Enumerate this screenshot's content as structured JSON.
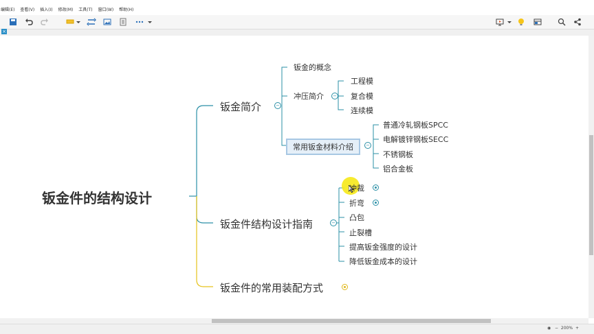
{
  "menu": {
    "items": [
      "编辑(E)",
      "查看(V)",
      "插入(I)",
      "修改(M)",
      "工具(T)",
      "窗口(W)",
      "帮助(H)"
    ]
  },
  "toolbar": {
    "left_icons": [
      "save-icon",
      "undo-icon",
      "redo-icon",
      "format-painter-icon",
      "dropdown-icon",
      "relationship-icon",
      "picture-icon",
      "outline-icon",
      "more-icon",
      "dropdown-icon"
    ],
    "right_icons": [
      "present-icon",
      "dropdown-icon",
      "bulb-icon",
      "panel-icon",
      "search-icon",
      "share-icon"
    ]
  },
  "mindmap": {
    "central": "钣金件的结构设计",
    "branch1": {
      "label": "钣金简介",
      "children": {
        "c1": "钣金的概念",
        "c2": {
          "label": "冲压简介",
          "items": [
            "工程模",
            "复合模",
            "连续模"
          ]
        },
        "c3": {
          "label": "常用钣金材料介绍",
          "items": [
            "普通冷轧钢板SPCC",
            "电解镀锌钢板SECC",
            "不锈钢板",
            "铝合金板"
          ]
        }
      }
    },
    "branch2": {
      "label": "钣金件结构设计指南",
      "items": [
        "冲裁",
        "折弯",
        "凸包",
        "止裂槽",
        "提高钣金强度的设计",
        "降低钣金成本的设计"
      ]
    },
    "branch3": {
      "label": "钣金件的常用装配方式"
    }
  },
  "status": {
    "zoom": "200%"
  },
  "colors": {
    "teal_line": "#2a8fa6",
    "yellow_line": "#e6c21a",
    "selection": "#a7c7e3",
    "highlight": "#f6e91a"
  }
}
